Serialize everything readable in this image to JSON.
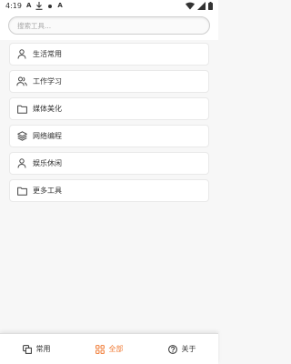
{
  "status_bar": {
    "time": "4:19",
    "glyphs": [
      "A",
      "A"
    ]
  },
  "search": {
    "placeholder": "搜索工具..."
  },
  "menu": {
    "items": [
      {
        "label": "生活常用",
        "icon": "person-icon"
      },
      {
        "label": "工作学习",
        "icon": "people-icon"
      },
      {
        "label": "媒体美化",
        "icon": "folder-icon"
      },
      {
        "label": "网络编程",
        "icon": "layers-icon"
      },
      {
        "label": "娱乐休闲",
        "icon": "person-icon"
      },
      {
        "label": "更多工具",
        "icon": "folder-icon"
      }
    ]
  },
  "bottom_nav": {
    "items": [
      {
        "label": "常用",
        "icon": "copy-icon",
        "active": false
      },
      {
        "label": "全部",
        "icon": "grid-icon",
        "active": true
      },
      {
        "label": "关于",
        "icon": "help-circle-icon",
        "active": false
      }
    ],
    "active_color": "#f07a33"
  }
}
